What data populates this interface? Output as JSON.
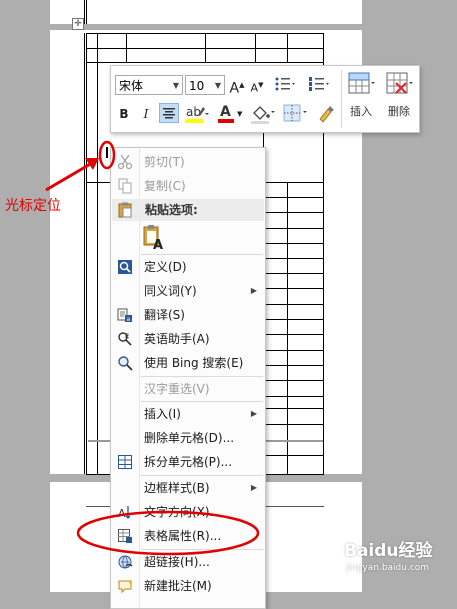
{
  "mini_toolbar": {
    "font_name": "宋体",
    "font_size": "10",
    "grow_font_glyph": "A",
    "shrink_font_glyph": "A",
    "bold": "B",
    "italic": "I",
    "font_color_glyph": "A",
    "insert_label": "插入",
    "delete_label": "删除"
  },
  "context_menu": {
    "cut": "剪切(T)",
    "copy": "复制(C)",
    "paste_options": "粘贴选项:",
    "define": "定义(D)",
    "synonyms": "同义词(Y)",
    "translate": "翻译(S)",
    "english_assistant": "英语助手(A)",
    "bing_search": "使用 Bing 搜索(E)",
    "reconvert": "汉字重选(V)",
    "insert": "插入(I)",
    "delete_cells": "删除单元格(D)...",
    "split_cells": "拆分单元格(P)...",
    "border_styles": "边框样式(B)",
    "text_direction": "文字方向(X)...",
    "table_properties": "表格属性(R)...",
    "hyperlink": "超链接(H)...",
    "new_comment": "新建批注(M)"
  },
  "annotation": {
    "text": "光标定位",
    "color": "#e00000"
  },
  "watermark": {
    "text": "Baidu经验",
    "url": "jingyan.baidu.com"
  },
  "colors": {
    "highlight": "#ffff00",
    "font_color": "#e00000",
    "ellipse": "#e00000",
    "page_bg": "#aeaeae"
  }
}
